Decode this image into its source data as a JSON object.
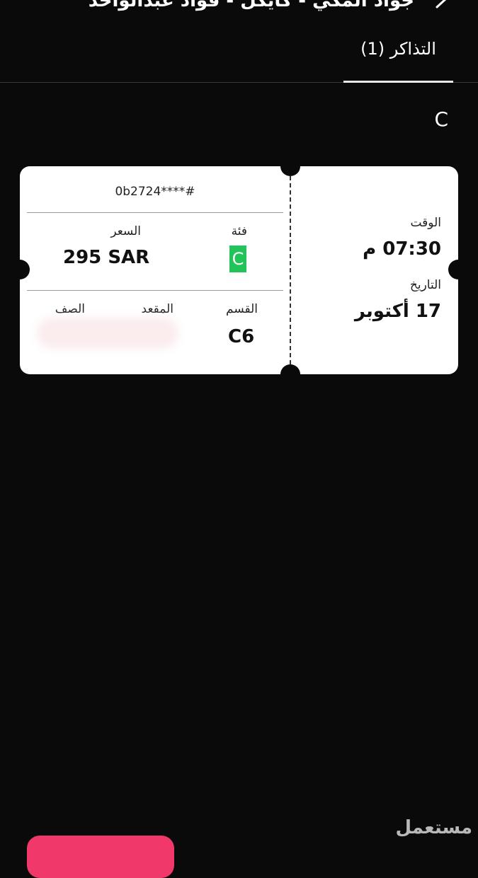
{
  "header": {
    "title": "جواد المكي - كايكل - فؤاد عبدالواحد"
  },
  "tabs": [
    {
      "label": "التذاكر (1)",
      "active": true
    }
  ],
  "section": {
    "letter": "C"
  },
  "ticket": {
    "code": "0b2724****#",
    "category_label": "فئة",
    "category_value": "C",
    "price_label": "السعر",
    "price_value": "295 SAR",
    "block_label": "القسم",
    "block_value": "C6",
    "seat_label": "المقعد",
    "row_label": "الصف",
    "time_label": "الوقت",
    "time_value": "07:30 م",
    "date_label": "التاريخ",
    "date_value": "17 أكتوبر"
  },
  "watermark": "مستعمل",
  "colors": {
    "background": "#0a0a0a",
    "category_badge": "#22c45a",
    "accent_button": "#f0386b"
  }
}
